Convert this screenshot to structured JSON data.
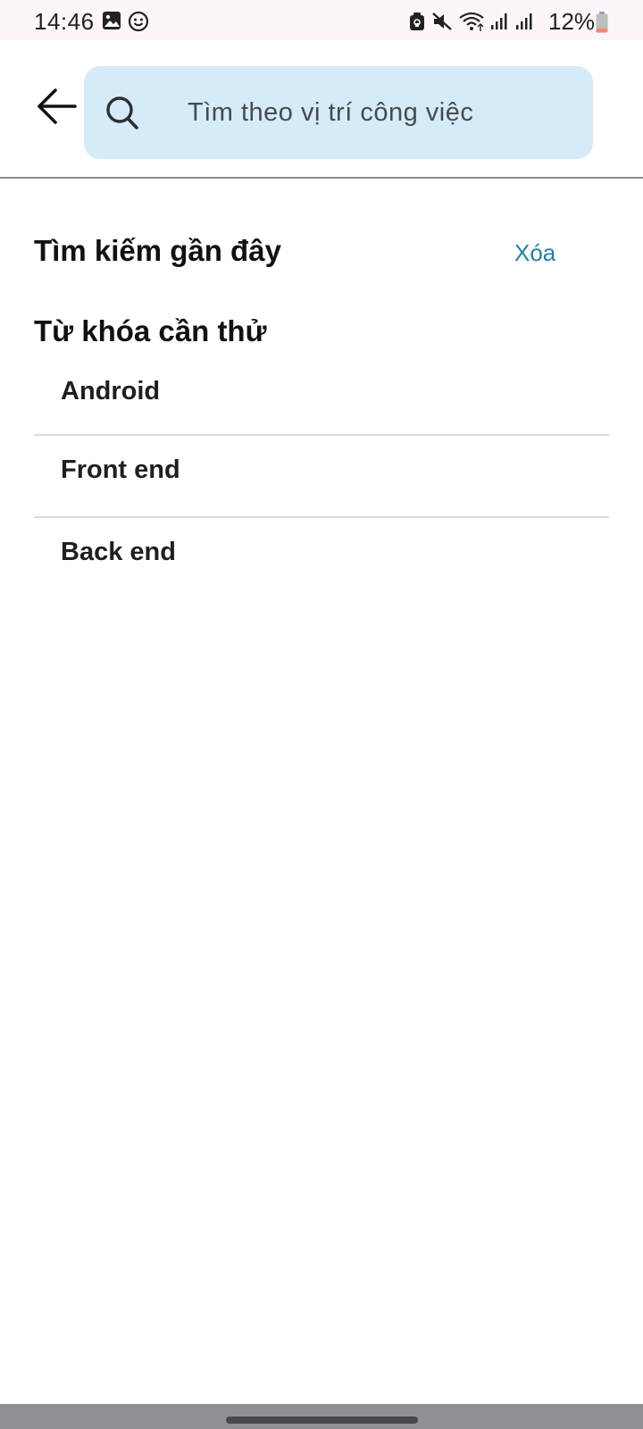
{
  "status_bar": {
    "time": "14:46",
    "battery": "12%",
    "left_icons": [
      "gallery-icon",
      "emoji-face-icon"
    ],
    "right_icons": [
      "app-lock-icon",
      "mute-icon",
      "wifi-icon",
      "signal-icon",
      "signal-icon",
      "battery-icon"
    ]
  },
  "header": {
    "back_icon": "arrow-left-icon",
    "search": {
      "icon": "search-icon",
      "placeholder": "Tìm theo vị trí công việc",
      "value": ""
    }
  },
  "recent_section": {
    "title": "Tìm kiếm gần đây",
    "clear_label": "Xóa"
  },
  "suggested_section": {
    "title": "Từ khóa cần thử",
    "items": [
      {
        "label": "Android"
      },
      {
        "label": "Front end"
      },
      {
        "label": "Back end"
      }
    ]
  },
  "colors": {
    "search_background": "#d5ecf8",
    "link": "#2c7ea1",
    "status_bar_background": "#fcf6fc",
    "nav_bar_background": "#928f96",
    "battery_low": "#f08a70"
  }
}
